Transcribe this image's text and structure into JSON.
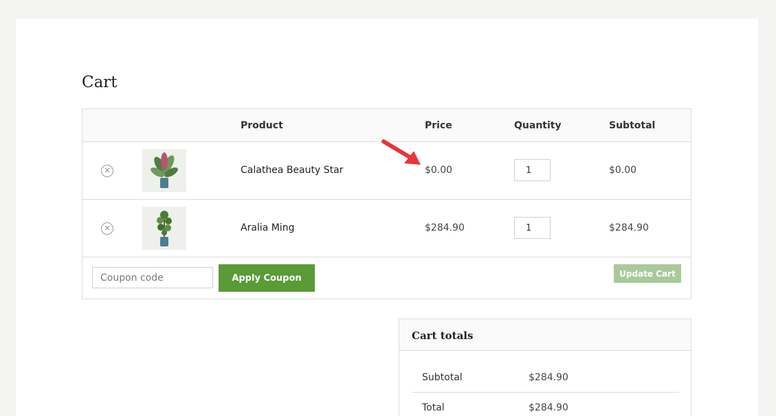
{
  "page": {
    "title": "Cart"
  },
  "table": {
    "headers": {
      "product": "Product",
      "price": "Price",
      "quantity": "Quantity",
      "subtotal": "Subtotal"
    },
    "rows": [
      {
        "name": "Calathea Beauty Star",
        "price": "$0.00",
        "quantity": "1",
        "subtotal": "$0.00"
      },
      {
        "name": "Aralia Ming",
        "price": "$284.90",
        "quantity": "1",
        "subtotal": "$284.90"
      }
    ],
    "remove_glyph": "✕"
  },
  "actions": {
    "coupon_placeholder": "Coupon code",
    "apply_label": "Apply Coupon",
    "update_label": "Update Cart"
  },
  "totals": {
    "title": "Cart totals",
    "subtotal_label": "Subtotal",
    "subtotal_value": "$284.90",
    "total_label": "Total",
    "total_value": "$284.90"
  },
  "colors": {
    "accent": "#5a9a37",
    "accent_disabled": "#a9c99a",
    "annotation": "#e8353a"
  }
}
